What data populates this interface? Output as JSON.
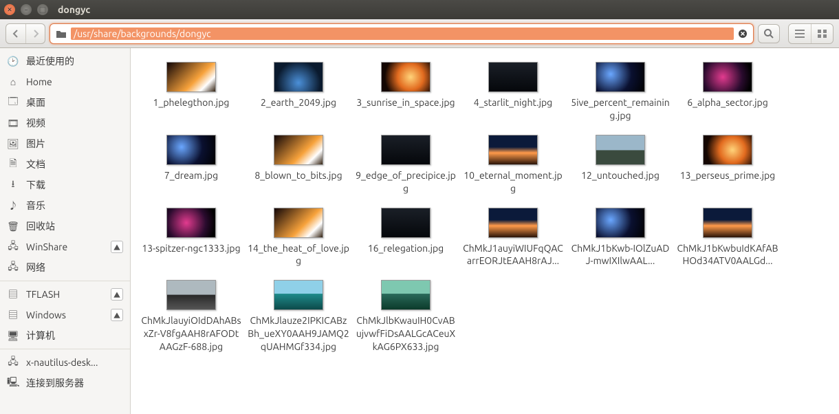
{
  "window": {
    "title": "dongyc"
  },
  "path": "/usr/share/backgrounds/dongyc",
  "sidebar": {
    "recent": "最近使用的",
    "home": "Home",
    "desktop": "桌面",
    "videos": "视频",
    "pictures": "图片",
    "documents": "文档",
    "downloads": "下载",
    "music": "音乐",
    "trash": "回收站",
    "winshare": "WinShare",
    "network": "网络",
    "tflash": "TFLASH",
    "windows": "Windows",
    "computer": "计算机",
    "nautilus": "x-nautilus-desk...",
    "connect": "连接到服务器"
  },
  "files": [
    {
      "name": "1_phelegthon.jpg",
      "theme": "fire"
    },
    {
      "name": "2_earth_2049.jpg",
      "theme": "earth"
    },
    {
      "name": "3_sunrise_in_space.jpg",
      "theme": "orange"
    },
    {
      "name": "4_starlit_night.jpg",
      "theme": "dark"
    },
    {
      "name": "5ive_percent_remaining.jpg",
      "theme": "space"
    },
    {
      "name": "6_alpha_sector.jpg",
      "theme": "nebula"
    },
    {
      "name": "7_dream.jpg",
      "theme": "space"
    },
    {
      "name": "8_blown_to_bits.jpg",
      "theme": "fire"
    },
    {
      "name": "9_edge_of_precipice.jpg",
      "theme": "dark"
    },
    {
      "name": "10_eternal_moment.jpg",
      "theme": "dusk"
    },
    {
      "name": "12_untouched.jpg",
      "theme": "mtn"
    },
    {
      "name": "13_perseus_prime.jpg",
      "theme": "orange"
    },
    {
      "name": "13-spitzer-ngc1333.jpg",
      "theme": "nebula"
    },
    {
      "name": "14_the_heat_of_love.jpg",
      "theme": "fire"
    },
    {
      "name": "16_relegation.jpg",
      "theme": "dark"
    },
    {
      "name": "ChMkJ1auyiWIUFqQACarrEORJtEAAH8rAJ...",
      "theme": "dusk"
    },
    {
      "name": "ChMkJ1bKwb-IOlZuADJ-mwIXIlwAAL...",
      "theme": "space"
    },
    {
      "name": "ChMkJ1bKwbuIdKAfABHOd34ATV0AALGd...",
      "theme": "dusk"
    },
    {
      "name": "ChMkJlauyiOIdDAhABsxZr-V8fgAAH8rAFODtAAGzF-688.jpg",
      "theme": "reflect"
    },
    {
      "name": "ChMkJlauze2IPKICABzBh_ueXY0AAH9JAMQ2qUAHMGf334.jpg",
      "theme": "lake"
    },
    {
      "name": "ChMkJlbKwauIH0CvABujvwfFiDsAALGcACeuXkAG6PX633.jpg",
      "theme": "green"
    }
  ]
}
